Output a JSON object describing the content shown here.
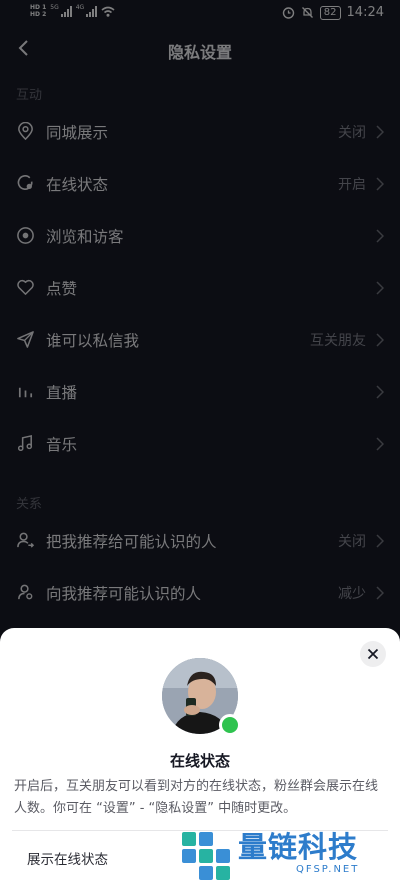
{
  "status_bar": {
    "hd1": "HD 1",
    "hd2": "HD 2",
    "net1": "5G",
    "net2": "4G",
    "battery": "82",
    "time": "14:24"
  },
  "nav": {
    "title": "隐私设置"
  },
  "sections": {
    "interaction": "互动",
    "relations": "关系"
  },
  "rows": [
    {
      "label": "同城展示",
      "value": "关闭",
      "icon": "location-pin-icon"
    },
    {
      "label": "在线状态",
      "value": "开启",
      "icon": "online-status-icon"
    },
    {
      "label": "浏览和访客",
      "value": "",
      "icon": "eye-icon"
    },
    {
      "label": "点赞",
      "value": "",
      "icon": "heart-icon"
    },
    {
      "label": "谁可以私信我",
      "value": "互关朋友",
      "icon": "send-icon"
    },
    {
      "label": "直播",
      "value": "",
      "icon": "live-bars-icon"
    },
    {
      "label": "音乐",
      "value": "",
      "icon": "music-note-icon"
    },
    {
      "label": "把我推荐给可能认识的人",
      "value": "关闭",
      "icon": "share-user-icon"
    },
    {
      "label": "向我推荐可能认识的人",
      "value": "减少",
      "icon": "users-icon"
    }
  ],
  "sheet": {
    "title": "在线状态",
    "description": "开启后，互关朋友可以看到对方的在线状态，粉丝群会展示在线人数。你可在 “设置” - “隐私设置” 中随时更改。",
    "toggle_label": "展示在线状态",
    "online_color": "#2fc34f"
  },
  "watermark": {
    "text": "量链科技",
    "sub": "QFSP.NET"
  },
  "colors": {
    "background": "#161823",
    "sheet": "#ffffff",
    "watermark": "#2d7ccb"
  }
}
